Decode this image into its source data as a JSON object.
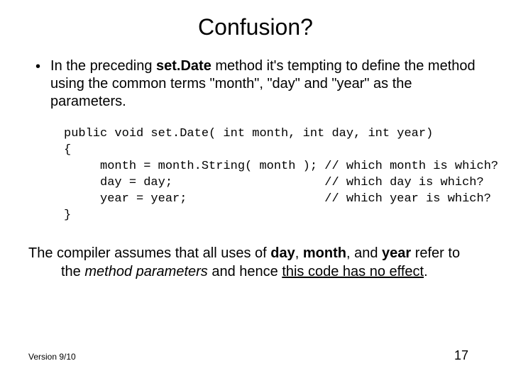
{
  "title": "Confusion?",
  "bullet": {
    "pre": "In the preceding ",
    "bold1": "set.Date",
    "post": " method it's tempting to define the method using the common terms \"month\", \"day\" and \"year\" as the parameters."
  },
  "code": {
    "l1": "public void set.Date( int month, int day, int year)",
    "l2": "{",
    "l3": "     month = month.String( month ); // which month is which?",
    "l4": "     day = day;                     // which day is which?",
    "l5": "     year = year;                   // which year is which?",
    "l6": "}"
  },
  "summary": {
    "s1": "The compiler assumes that all uses of ",
    "b1": "day",
    "s2": ", ",
    "b2": "month",
    "s3": ", and ",
    "b3": "year",
    "s4": " refer to the ",
    "i1": "method parameters",
    "s5": " and hence ",
    "u1": "this code has no effect",
    "s6": "."
  },
  "footer": {
    "left": "Version 9/10",
    "right": "17"
  }
}
